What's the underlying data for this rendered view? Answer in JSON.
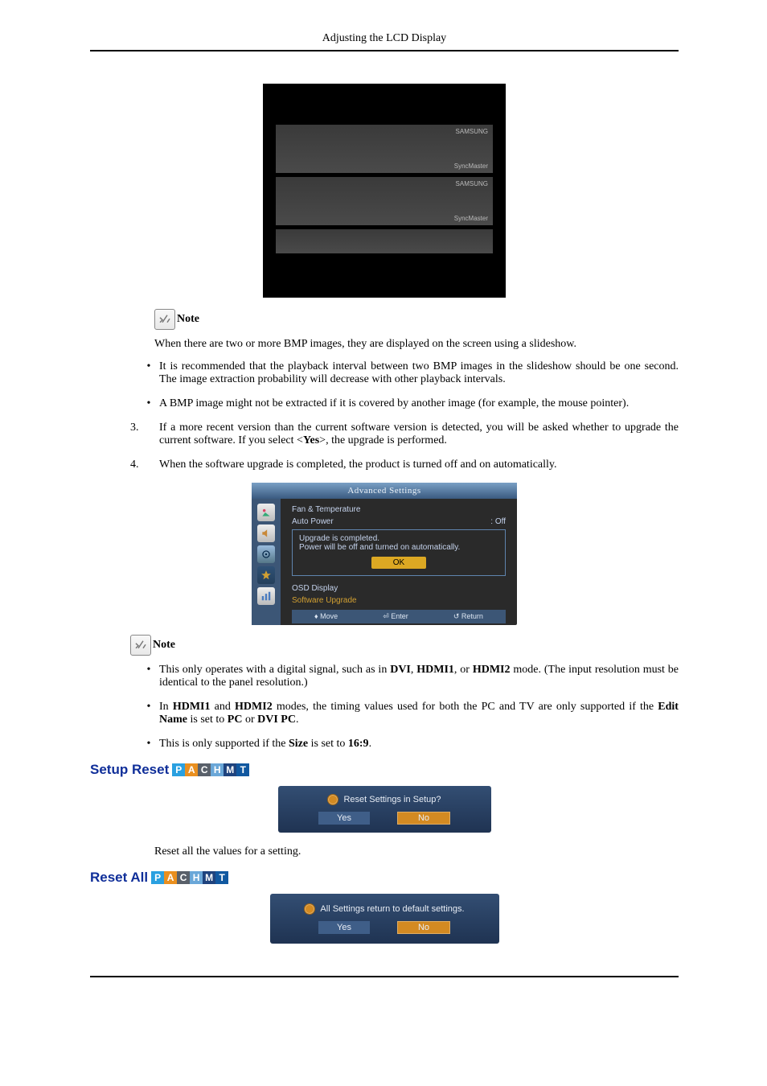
{
  "header": {
    "title": "Adjusting the LCD Display"
  },
  "note_label": "Note",
  "para_slideshow": "When there are two or more BMP images, they are displayed on the screen using a slideshow.",
  "bullets_a": [
    "It is recommended that the playback interval between two BMP images in the slideshow should be one second. The image extraction probability will decrease with other playback intervals.",
    "A BMP image might not be extracted if it is covered by another image (for example, the mouse pointer)."
  ],
  "numbered": [
    {
      "n": "3.",
      "t_before": "If a more recent version than the current software version is detected, you will be asked whether to upgrade the current software. If you select <",
      "t_bold": "Yes",
      "t_after": ">, the upgrade is performed."
    },
    {
      "n": "4.",
      "t_before": "When the software upgrade is completed, the product is turned off and on automatically.",
      "t_bold": "",
      "t_after": ""
    }
  ],
  "osd": {
    "title": "Advanced Settings",
    "fan": "Fan & Temperature",
    "auto_power": "Auto Power",
    "auto_power_val": ": Off",
    "msg1": "Upgrade is completed.",
    "msg2": "Power will be off and turned on automatically.",
    "ok": "OK",
    "osd_display": "OSD Display",
    "sw_upgrade": "Software Upgrade",
    "foot_move": "Move",
    "foot_enter": "Enter",
    "foot_return": "Return"
  },
  "bullets_b": [
    {
      "pre": "This only operates with a digital signal, such as in ",
      "b1": "DVI",
      "mid1": ", ",
      "b2": "HDMI1",
      "mid2": ", or ",
      "b3": "HDMI2",
      "post": " mode. (The input resolution must be identical to the panel resolution.)"
    },
    {
      "pre": "In ",
      "b1": "HDMI1",
      "mid1": " and ",
      "b2": "HDMI2",
      "mid2": " modes, the timing values used for both the PC and TV are only supported if the ",
      "b3": "Edit Name",
      "post_mid": " is set to ",
      "b4": "PC",
      "mid3": " or ",
      "b5": "DVI PC",
      "post": "."
    },
    {
      "pre": "This is only supported if the ",
      "b1": "Size",
      "mid1": " is set to ",
      "b2": "16:9",
      "post": "."
    }
  ],
  "section_setup_reset": "Setup Reset",
  "dlg1": {
    "title": "Reset Settings in Setup?",
    "yes": "Yes",
    "no": "No"
  },
  "para_reset_all_vals": "Reset all the values for a setting.",
  "section_reset_all": "Reset All",
  "dlg2": {
    "title": "All Settings return to default settings.",
    "yes": "Yes",
    "no": "No"
  },
  "modes": {
    "p": "P",
    "a": "A",
    "c": "C",
    "h": "H",
    "m": "M",
    "t": "T"
  }
}
